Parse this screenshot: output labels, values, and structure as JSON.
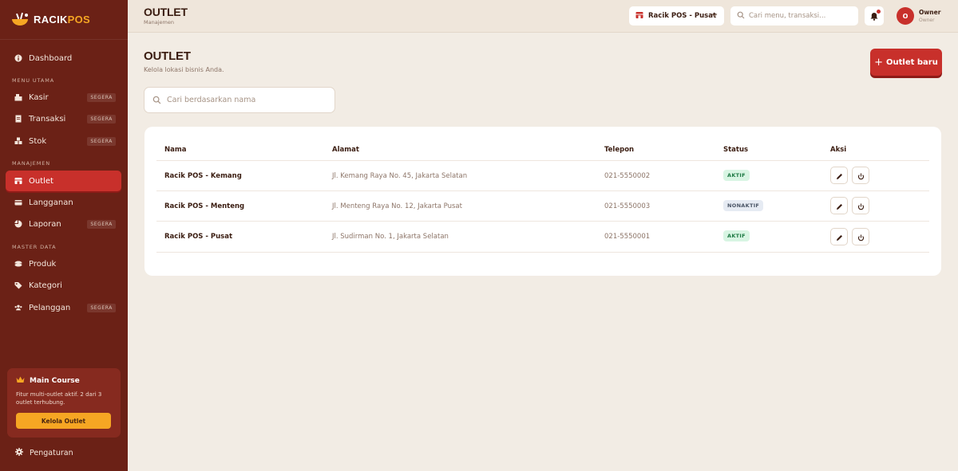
{
  "brand": {
    "part1": "RACIK",
    "part2": "POS"
  },
  "sidebar": {
    "dashboard": "Dashboard",
    "section_main": "MENU UTAMA",
    "kasir": "Kasir",
    "transaksi": "Transaksi",
    "stok": "Stok",
    "section_manage": "MANAJEMEN",
    "outlet": "Outlet",
    "langganan": "Langganan",
    "laporan": "Laporan",
    "section_master": "MASTER DATA",
    "produk": "Produk",
    "kategori": "Kategori",
    "pelanggan": "Pelanggan",
    "soon": "SEGERA",
    "promo": {
      "title": "Main Course",
      "desc": "Fitur multi-outlet aktif. 2 dari 3 outlet terhubung.",
      "button": "Kelola Outlet"
    },
    "settings": "Pengaturan"
  },
  "topbar": {
    "title": "OUTLET",
    "subtitle": "Manajemen",
    "outlet_selected": "Racik POS - Pusat",
    "search_placeholder": "Cari menu, transaksi...",
    "avatar_initial": "O",
    "user_name": "Owner",
    "user_role": "Owner"
  },
  "page": {
    "title": "OUTLET",
    "subtitle": "Kelola lokasi bisnis Anda.",
    "new_button": "Outlet baru",
    "search_placeholder": "Cari berdasarkan nama"
  },
  "table": {
    "headers": {
      "name": "Nama",
      "address": "Alamat",
      "phone": "Telepon",
      "status": "Status",
      "actions": "Aksi"
    },
    "rows": [
      {
        "name": "Racik POS - Kemang",
        "address": "Jl. Kemang Raya No. 45, Jakarta Selatan",
        "phone": "021-5550002",
        "status": "AKTIF"
      },
      {
        "name": "Racik POS - Menteng",
        "address": "Jl. Menteng Raya No. 12, Jakarta Pusat",
        "phone": "021-5550003",
        "status": "NONAKTIF"
      },
      {
        "name": "Racik POS - Pusat",
        "address": "Jl. Sudirman No. 1, Jakarta Selatan",
        "phone": "021-5550001",
        "status": "AKTIF"
      }
    ]
  },
  "colors": {
    "sidebar": "#6b2116",
    "accent": "#c8302b",
    "promo_button": "#f6a623",
    "background": "#f2ece4"
  },
  "icons": [
    "logo-bowl-icon",
    "info-icon",
    "cash-register-icon",
    "receipt-icon",
    "boxes-icon",
    "store-icon",
    "card-icon",
    "chart-pie-icon",
    "bowl-icon",
    "tag-icon",
    "users-icon",
    "crown-icon",
    "gear-icon",
    "chevron-down-icon",
    "search-icon",
    "bell-icon",
    "plus-icon",
    "pencil-icon",
    "power-icon"
  ]
}
